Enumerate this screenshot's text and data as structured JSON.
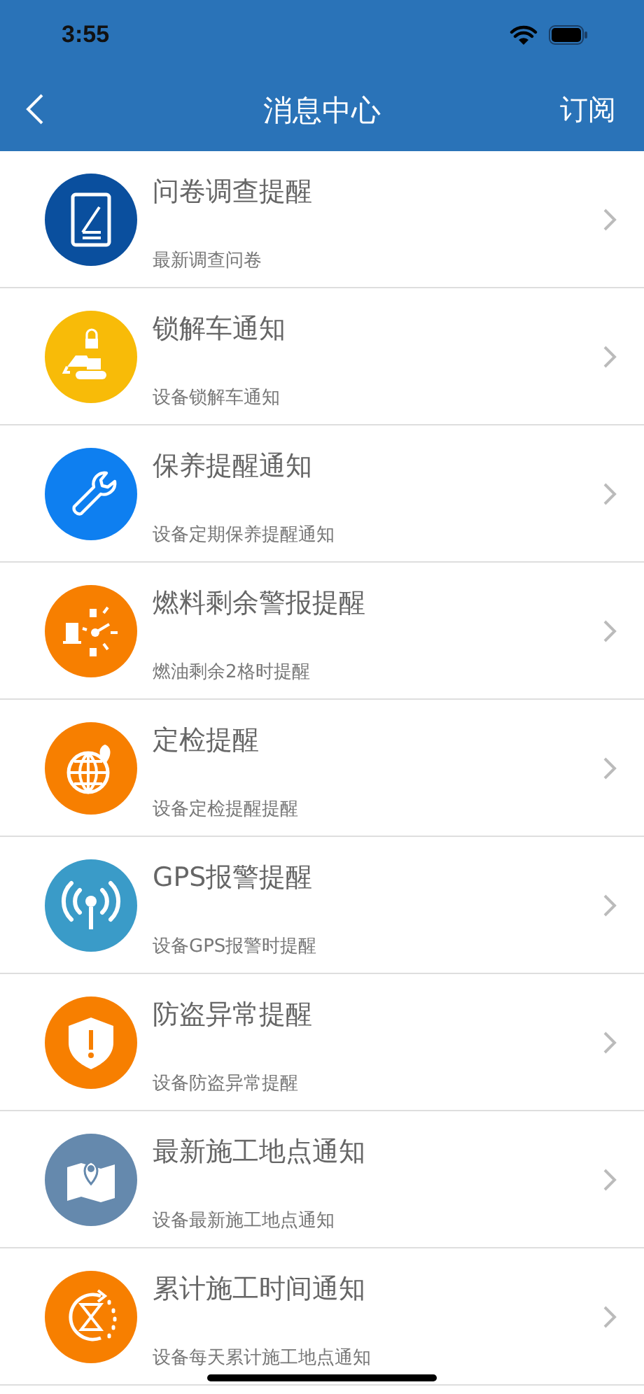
{
  "status_bar": {
    "time": "3:55"
  },
  "nav": {
    "title": "消息中心",
    "action": "订阅"
  },
  "items": [
    {
      "kind": "tablet",
      "color": "#0a4f9e",
      "title": "问卷调查提醒",
      "subtitle": "最新调查问卷"
    },
    {
      "kind": "excavator",
      "color": "#f8bb08",
      "title": "锁解车通知",
      "subtitle": "设备锁解车通知"
    },
    {
      "kind": "wrench",
      "color": "#0e7ff0",
      "title": "保养提醒通知",
      "subtitle": "设备定期保养提醒通知"
    },
    {
      "kind": "gauge",
      "color": "#f77f00",
      "title": "燃料剩余警报提醒",
      "subtitle": "燃油剩余2格时提醒"
    },
    {
      "kind": "globe",
      "color": "#f77f00",
      "title": "定检提醒",
      "subtitle": "设备定检提醒提醒"
    },
    {
      "kind": "antenna",
      "color": "#3a9bc8",
      "title": "GPS报警提醒",
      "subtitle": "设备GPS报警时提醒"
    },
    {
      "kind": "shield",
      "color": "#f77f00",
      "title": "防盗异常提醒",
      "subtitle": "设备防盗异常提醒"
    },
    {
      "kind": "map",
      "color": "#6589ad",
      "title": "最新施工地点通知",
      "subtitle": "设备最新施工地点通知"
    },
    {
      "kind": "hourglass",
      "color": "#f77f00",
      "title": "累计施工时间通知",
      "subtitle": "设备每天累计施工地点通知"
    }
  ]
}
